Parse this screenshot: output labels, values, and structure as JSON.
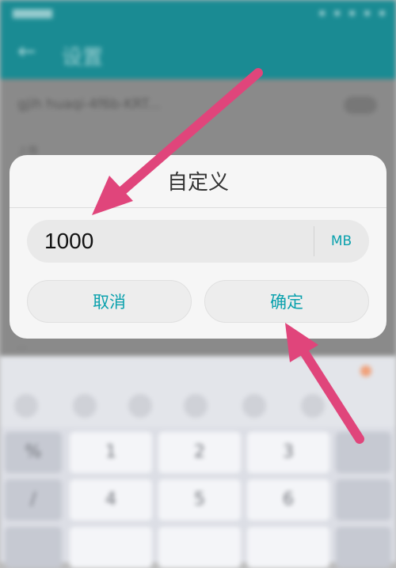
{
  "background": {
    "app_bar": {
      "title": "设置"
    },
    "settings": {
      "wifi_name": "gjih huaqi-4f6b-KRT...",
      "sub_label": "上限",
      "hint": "..."
    },
    "keyboard": {
      "keys": [
        {
          "name": "key-symbols",
          "label": "%"
        },
        {
          "name": "key-1",
          "label": "1"
        },
        {
          "name": "key-2",
          "label": "2"
        },
        {
          "name": "key-3",
          "label": "3"
        },
        {
          "name": "key-slash",
          "label": "/"
        },
        {
          "name": "key-4",
          "label": "4"
        },
        {
          "name": "key-5",
          "label": "5"
        },
        {
          "name": "key-6",
          "label": "6"
        }
      ]
    }
  },
  "dialog": {
    "title": "自定义",
    "input_value": "1000",
    "unit": "MB",
    "cancel_label": "取消",
    "confirm_label": "确定"
  },
  "colors": {
    "accent": "#0aa1ad",
    "app_bar": "#1a8b93",
    "annotation_arrow": "#e0457b"
  }
}
